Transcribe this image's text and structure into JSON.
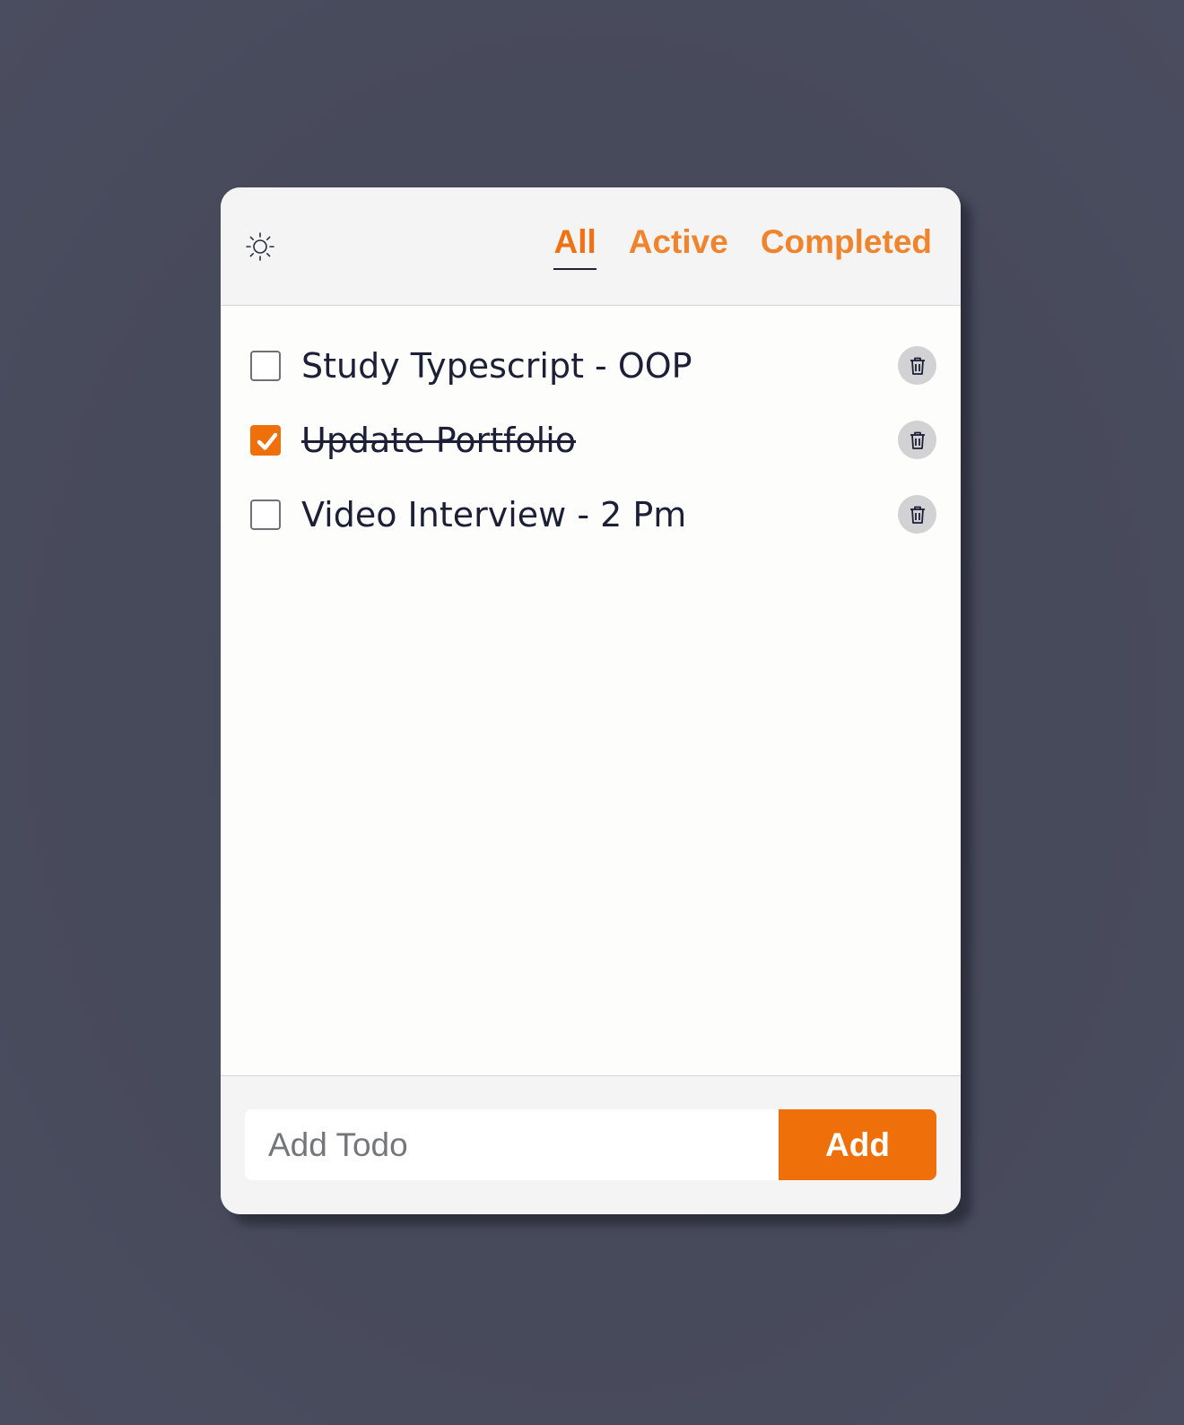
{
  "header": {
    "theme_icon": "sun-icon",
    "tabs": [
      {
        "label": "All",
        "selected": true
      },
      {
        "label": "Active",
        "selected": false
      },
      {
        "label": "Completed",
        "selected": false
      }
    ]
  },
  "todos": [
    {
      "text": "Study Typescript - OOP",
      "completed": false
    },
    {
      "text": "Update Portfolio",
      "completed": true
    },
    {
      "text": "Video Interview - 2 Pm",
      "completed": false
    }
  ],
  "footer": {
    "input_placeholder": "Add Todo",
    "input_value": "",
    "add_label": "Add"
  },
  "colors": {
    "accent": "#ef6f0a",
    "tab_text": "#f0842d",
    "text": "#1c1f36",
    "background": "#474a5b"
  },
  "icons": {
    "delete": "trash-icon",
    "check": "checkmark-icon"
  }
}
